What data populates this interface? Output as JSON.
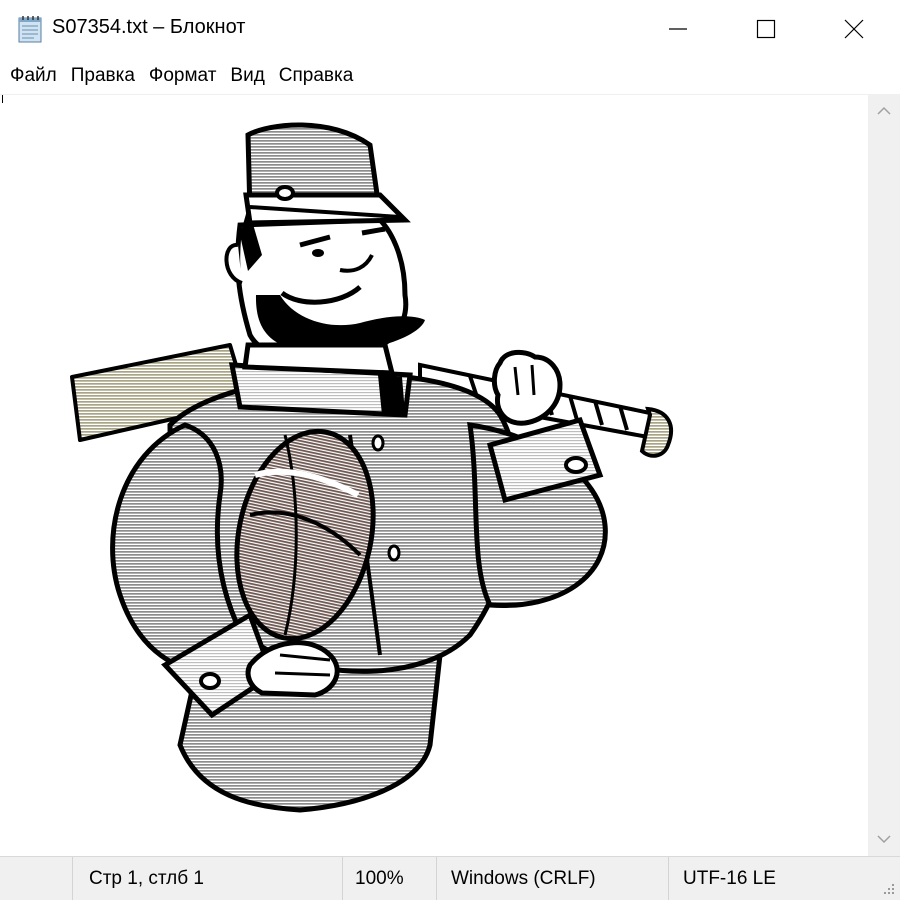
{
  "window": {
    "title": "S07354.txt – Блокнот",
    "app_icon": "notepad-icon"
  },
  "controls": {
    "minimize_icon": "minimize-icon",
    "maximize_icon": "maximize-icon",
    "close_icon": "close-icon"
  },
  "menu": {
    "items": [
      {
        "label": "Файл"
      },
      {
        "label": "Правка"
      },
      {
        "label": "Формат"
      },
      {
        "label": "Вид"
      },
      {
        "label": "Справка"
      }
    ]
  },
  "content": {
    "image": "cartoon-soldier-with-bat-and-ball"
  },
  "status": {
    "position": "Стр 1, стлб 1",
    "zoom": "100%",
    "line_endings": "Windows (CRLF)",
    "encoding": "UTF-16 LE"
  },
  "colors": {
    "gray": "#a6a6a6",
    "bat": "#c8c4a8",
    "ball": "#8f7a74",
    "outline": "#000000"
  }
}
